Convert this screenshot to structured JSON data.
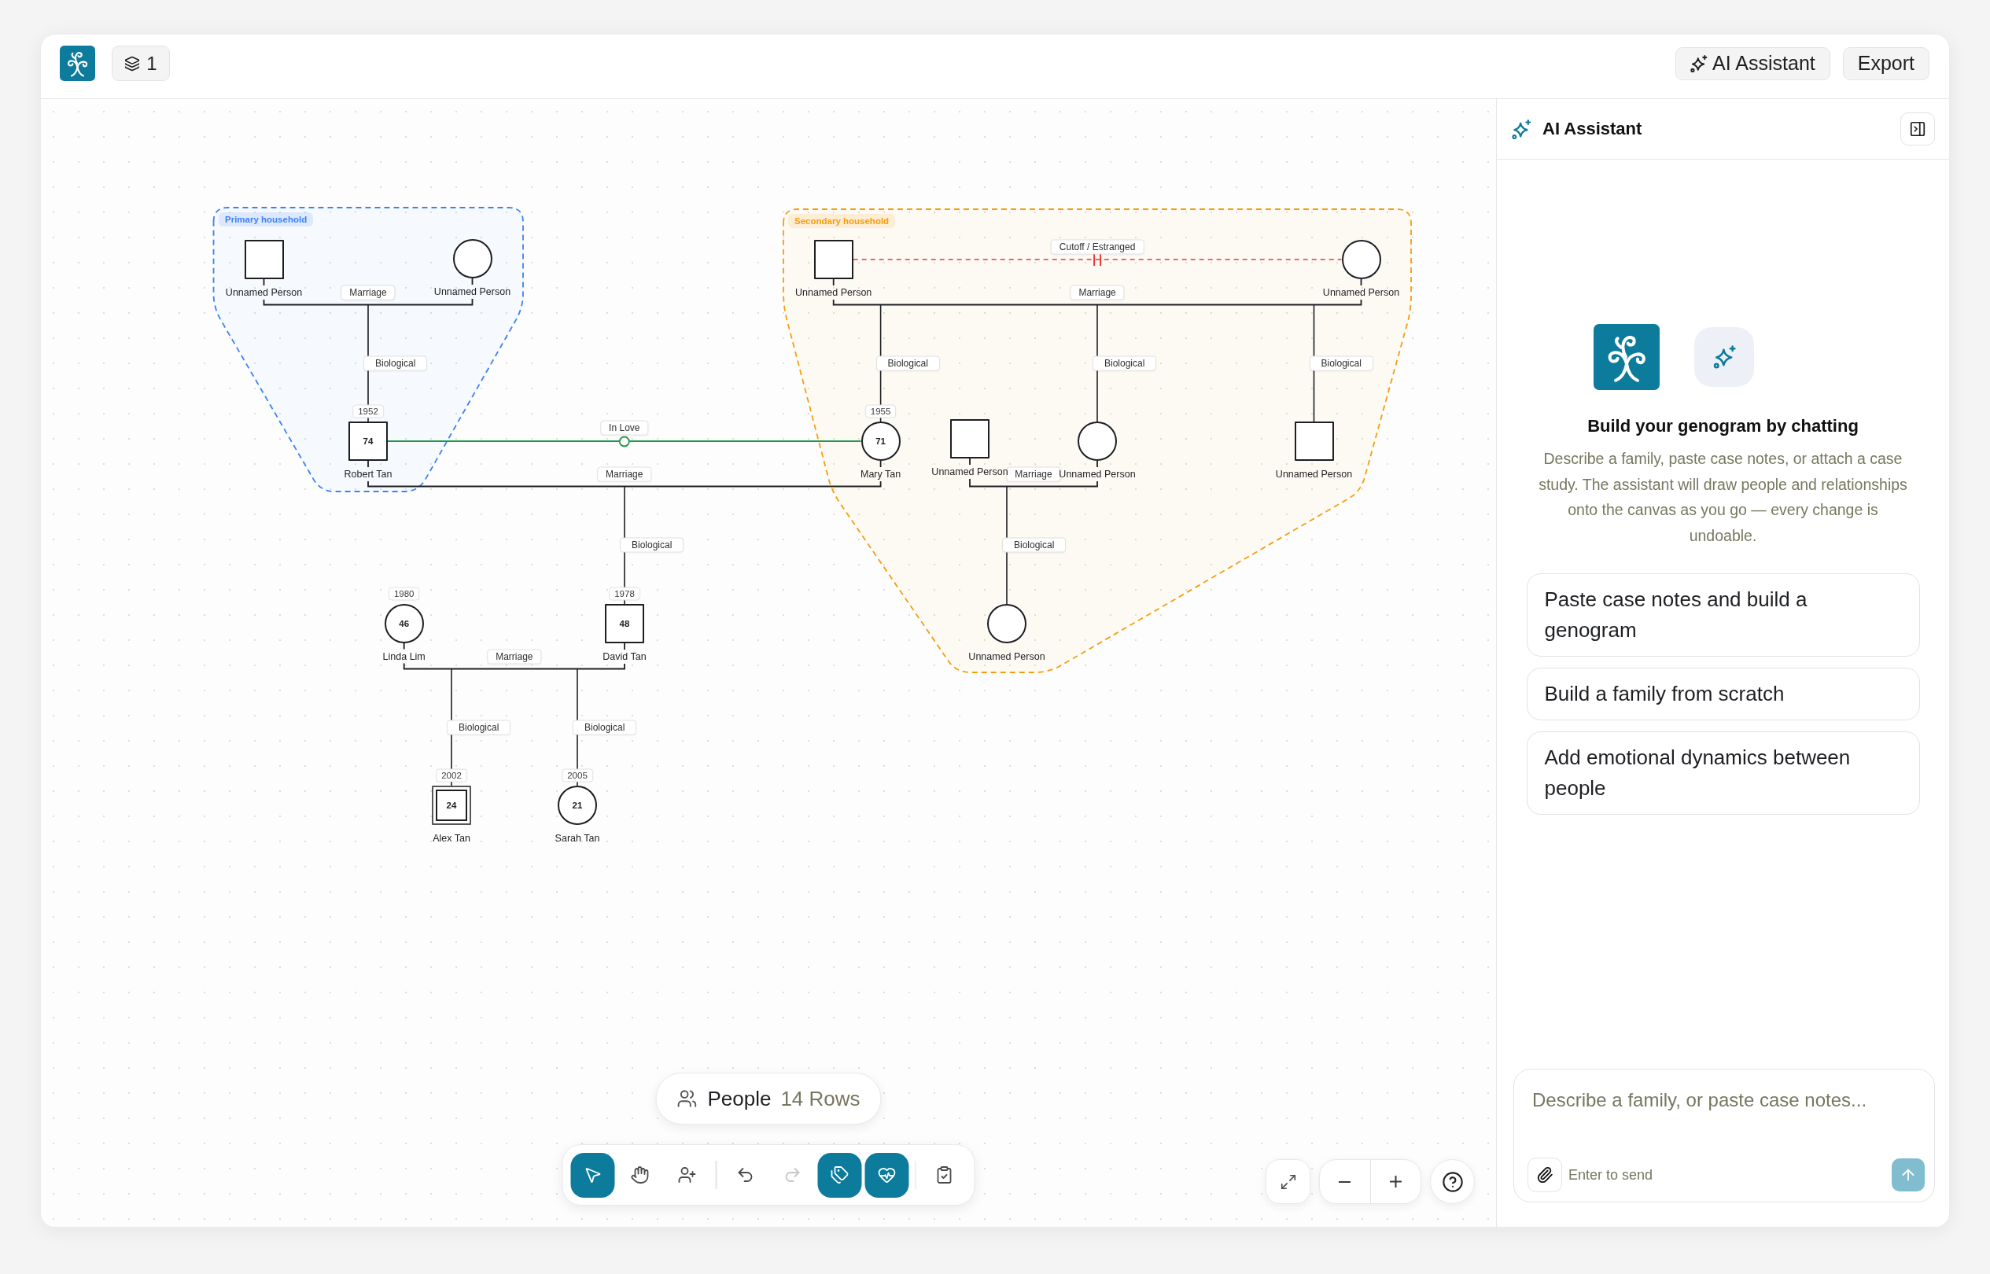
{
  "header": {
    "layer_count": "1",
    "buttons": [
      {
        "kind": "assistant",
        "label": "AI Assistant"
      },
      {
        "kind": "export",
        "label": "Export"
      }
    ]
  },
  "canvas": {
    "groups": [
      {
        "label": "Primary household",
        "color": "#3b82f6"
      },
      {
        "label": "Secondary household",
        "color": "#f59e0b"
      }
    ],
    "people": [
      {
        "kind": "male",
        "name": "Unnamed Person",
        "index_person": false
      },
      {
        "kind": "female",
        "name": "Unnamed Person",
        "index_person": false
      },
      {
        "kind": "male",
        "name": "Unnamed Person",
        "index_person": false
      },
      {
        "kind": "female",
        "name": "Unnamed Person",
        "index_person": false
      },
      {
        "kind": "male",
        "name": "Robert Tan",
        "year": "1952",
        "age": "74",
        "index_person": false
      },
      {
        "kind": "female",
        "name": "Mary Tan",
        "year": "1955",
        "age": "71",
        "index_person": false
      },
      {
        "kind": "male",
        "name": "Unnamed Person",
        "index_person": false
      },
      {
        "kind": "female",
        "name": "Unnamed Person",
        "index_person": false
      },
      {
        "kind": "male",
        "name": "Unnamed Person",
        "index_person": false
      },
      {
        "kind": "female",
        "name": "Linda Lim",
        "year": "1980",
        "age": "46",
        "index_person": false
      },
      {
        "kind": "male",
        "name": "David Tan",
        "year": "1978",
        "age": "48",
        "index_person": false
      },
      {
        "kind": "female",
        "name": "Unnamed Person",
        "index_person": false
      },
      {
        "kind": "male",
        "name": "Alex Tan",
        "year": "2002",
        "age": "24",
        "index_person": true
      },
      {
        "kind": "female",
        "name": "Sarah Tan",
        "year": "2005",
        "age": "21",
        "index_person": false
      }
    ],
    "relationships": [
      {
        "kind": "marriage",
        "label": "Marriage"
      },
      {
        "kind": "cutoff",
        "label": "Cutoff / Estranged"
      },
      {
        "kind": "marriage",
        "label": "Marriage"
      },
      {
        "kind": "in_love",
        "label": "In Love"
      },
      {
        "kind": "marriage",
        "label": "Marriage"
      },
      {
        "kind": "marriage",
        "label": "Marriage"
      },
      {
        "kind": "marriage",
        "label": "Marriage"
      }
    ],
    "child_links": [
      {
        "label": "Biological"
      },
      {
        "label": "Biological"
      },
      {
        "label": "Biological"
      },
      {
        "label": "Biological"
      },
      {
        "label": "Biological"
      },
      {
        "label": "Biological"
      },
      {
        "label": "Biological"
      },
      {
        "label": "Biological"
      }
    ],
    "people_summary": {
      "label": "People",
      "count": "14 Rows"
    },
    "toolbar": {
      "tools": [
        {
          "kind": "select",
          "selected": true
        },
        {
          "kind": "pan",
          "selected": false
        },
        {
          "kind": "add_person",
          "selected": false
        }
      ],
      "history": [
        {
          "kind": "undo",
          "disabled": false
        },
        {
          "kind": "redo",
          "disabled": true
        }
      ],
      "toggles": [
        {
          "kind": "labels",
          "on": true
        },
        {
          "kind": "emotional",
          "on": true
        }
      ]
    }
  },
  "assistant_panel": {
    "title": "AI Assistant",
    "heading": "Build your genogram by chatting",
    "description": "Describe a family, paste case notes, or attach a case study. The assistant will draw people and relationships onto the canvas as you go — every change is undoable.",
    "suggestions": [
      "Paste case notes and build a genogram",
      "Build a family from scratch",
      "Add emotional dynamics between people"
    ],
    "composer": {
      "placeholder": "Describe a family, or paste case notes...",
      "hint": "Enter to send",
      "send_disabled": true
    }
  }
}
